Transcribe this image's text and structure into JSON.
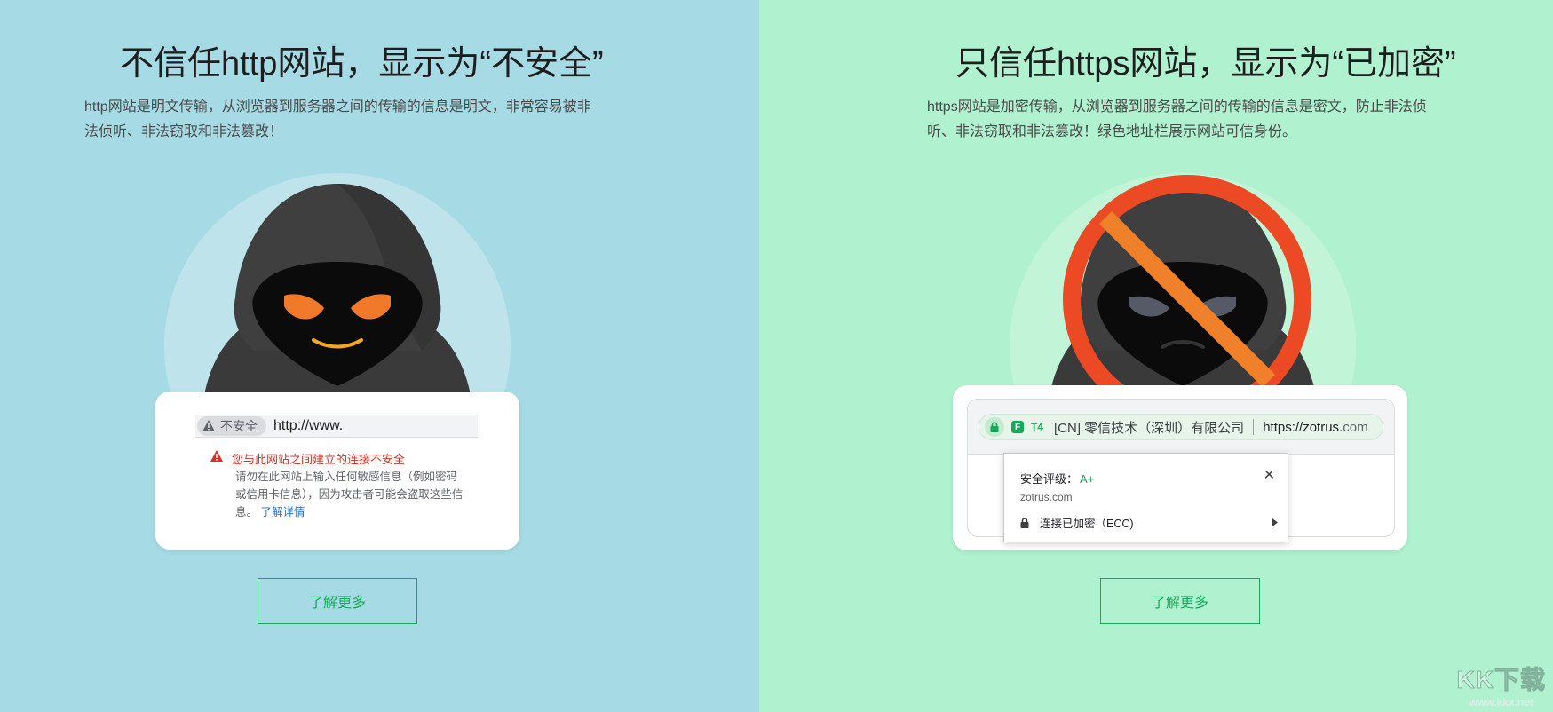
{
  "left": {
    "title": "不信任http网站，显示为“不安全”",
    "desc": "http网站是明文传输，从浏览器到服务器之间的传输的信息是明文，非常容易被非法侦听、非法窃取和非法篡改！",
    "address_bar": {
      "chip_label": "不安全",
      "url": "http://www."
    },
    "warning": {
      "title": "您与此网站之间建立的连接不安全",
      "body": "请勿在此网站上输入任何敏感信息（例如密码或信用卡信息），因为攻击者可能会盗取这些信息。",
      "learn_link": "了解详情"
    },
    "button": "了解更多",
    "colors": {
      "background": "#a6dae4",
      "warning": "#d93025",
      "link": "#1a73e8"
    }
  },
  "right": {
    "title": "只信任https网站，显示为“已加密”",
    "desc": "https网站是加密传输，从浏览器到服务器之间的传输的信息是密文，防止非法侦听、非法窃取和非法篡改！绿色地址栏展示网站可信身份。",
    "address_bar": {
      "f_icon": "F",
      "t_icon": "T4",
      "org": "[CN] 零信技术（深圳）有限公司",
      "url_main": "https://zotrus.",
      "url_tld": "com"
    },
    "popup": {
      "rating_label": "安全评级：",
      "rating_value": "A+",
      "domain": "zotrus.com",
      "close": "✕",
      "row_label": "连接已加密（ECC)"
    },
    "button": "了解更多",
    "colors": {
      "background": "#b0f2d0",
      "accent": "#17a85a"
    }
  },
  "watermark": {
    "logo": "KK下载",
    "url": "www.kkx.net"
  }
}
